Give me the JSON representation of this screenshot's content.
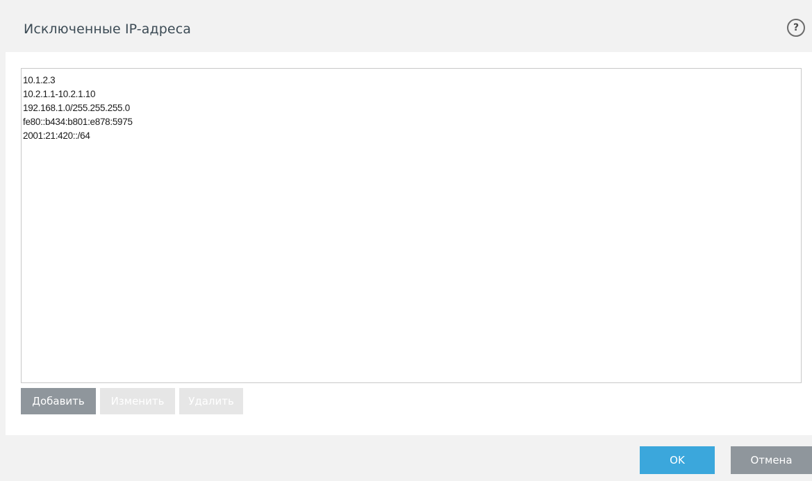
{
  "dialog": {
    "title": "Исключенные IP-адреса",
    "help_label": "?"
  },
  "list": {
    "items": [
      "10.1.2.3",
      "10.2.1.1-10.2.1.10",
      "192.168.1.0/255.255.255.0",
      "fe80::b434:b801:e878:5975",
      "2001:21:420::/64"
    ]
  },
  "actions": {
    "add_label": "Добавить",
    "edit_label": "Изменить",
    "delete_label": "Удалить"
  },
  "footer": {
    "ok_label": "OK",
    "cancel_label": "Отмена"
  },
  "colors": {
    "primary": "#3ba7dc",
    "secondary": "#8f969c",
    "disabled": "#e6e6e6",
    "chrome": "#f2f2f2"
  },
  "icons": {
    "help": "help-icon"
  }
}
